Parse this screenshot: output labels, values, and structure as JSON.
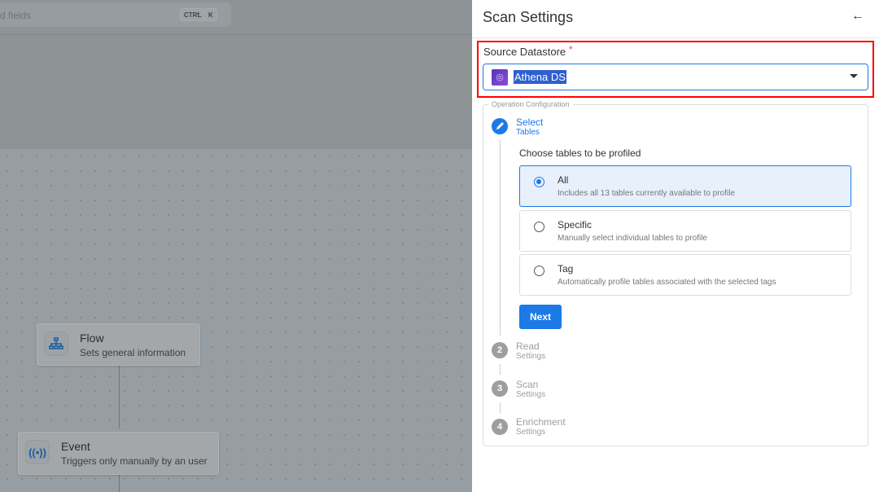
{
  "background": {
    "search": {
      "placeholder_visible": "d fields",
      "shortcut": [
        "CTRL",
        "K"
      ],
      "plus": "+"
    },
    "nodes": [
      {
        "title": "Flow",
        "subtitle": "Sets general information",
        "icon": "sitemap-icon"
      },
      {
        "title": "Event",
        "subtitle": "Triggers only manually by an user",
        "icon": "broadcast-icon",
        "glyph": "((•))"
      }
    ]
  },
  "panel": {
    "title": "Scan Settings",
    "back_icon": "←",
    "source": {
      "label": "Source Datastore",
      "required": "*",
      "value": "Athena DS",
      "icon": "athena-icon"
    },
    "operation": {
      "label": "Operation Configuration",
      "steps": [
        {
          "num": "1",
          "title": "Select",
          "subtitle": "Tables",
          "active": true
        },
        {
          "num": "2",
          "title": "Read",
          "subtitle": "Settings"
        },
        {
          "num": "3",
          "title": "Scan",
          "subtitle": "Settings"
        },
        {
          "num": "4",
          "title": "Enrichment",
          "subtitle": "Settings"
        }
      ],
      "prompt": "Choose tables to be profiled",
      "options": [
        {
          "title": "All",
          "desc": "Includes all 13 tables currently available to profile",
          "selected": true
        },
        {
          "title": "Specific",
          "desc": "Manually select individual tables to profile"
        },
        {
          "title": "Tag",
          "desc": "Automatically profile tables associated with the selected tags"
        }
      ],
      "next": "Next"
    }
  },
  "colors": {
    "accent": "#1c7ae6",
    "highlight": "#ff0000",
    "required": "#e0245e"
  }
}
